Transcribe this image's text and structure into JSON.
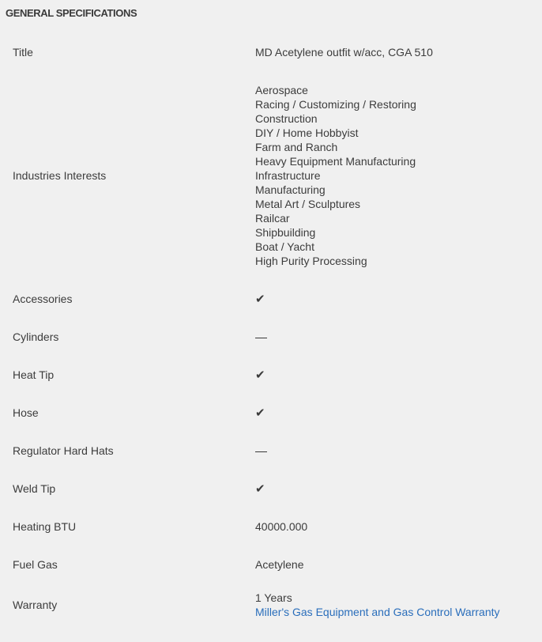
{
  "heading": "GENERAL SPECIFICATIONS",
  "rows": {
    "title": {
      "label": "Title",
      "value": "MD Acetylene outfit w/acc, CGA 510"
    },
    "industries": {
      "label": "Industries Interests",
      "values": [
        "Aerospace",
        "Racing / Customizing / Restoring",
        "Construction",
        "DIY / Home Hobbyist",
        "Farm and Ranch",
        "Heavy Equipment Manufacturing",
        "Infrastructure",
        "Manufacturing",
        "Metal Art / Sculptures",
        "Railcar",
        "Shipbuilding",
        "Boat / Yacht",
        "High Purity Processing"
      ]
    },
    "accessories": {
      "label": "Accessories",
      "value": "✔",
      "icon": "check-icon"
    },
    "cylinders": {
      "label": "Cylinders",
      "value": "",
      "icon": "dash-icon"
    },
    "heat_tip": {
      "label": "Heat Tip",
      "value": "✔",
      "icon": "check-icon"
    },
    "hose": {
      "label": "Hose",
      "value": "✔",
      "icon": "check-icon"
    },
    "regulator_hard_hats": {
      "label": "Regulator Hard Hats",
      "value": "",
      "icon": "dash-icon"
    },
    "weld_tip": {
      "label": "Weld Tip",
      "value": "✔",
      "icon": "check-icon"
    },
    "heating_btu": {
      "label": "Heating BTU",
      "value": "40000.000"
    },
    "fuel_gas": {
      "label": "Fuel Gas",
      "value": "Acetylene"
    },
    "warranty": {
      "label": "Warranty",
      "value": "1 Years",
      "link": "Miller's Gas Equipment and Gas Control Warranty"
    }
  },
  "colors": {
    "background": "#f0f0f0",
    "text": "#3c3c3c",
    "link": "#2a6ebb"
  }
}
